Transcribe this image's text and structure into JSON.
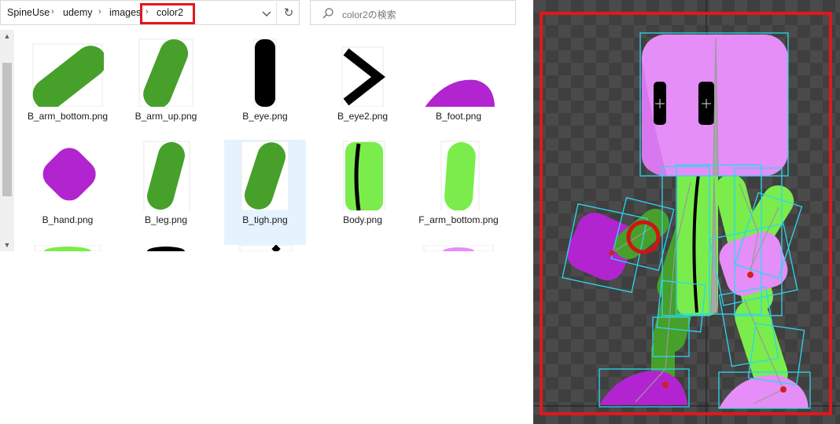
{
  "address_bar": {
    "breadcrumbs": [
      "SpineUse",
      "udemy",
      "images",
      "color2"
    ],
    "highlight_color": "#e0181b"
  },
  "search": {
    "placeholder": "color2の検索"
  },
  "files": [
    {
      "name": "B_arm_bottom.png",
      "color": "#46a02a",
      "shape": "wide-capsule"
    },
    {
      "name": "B_arm_up.png",
      "color": "#46a02a",
      "shape": "capsule"
    },
    {
      "name": "B_eye.png",
      "color": "#000000",
      "shape": "bar"
    },
    {
      "name": "B_eye2.png",
      "color": "#000000",
      "shape": "chevron"
    },
    {
      "name": "B_foot.png",
      "color": "#b224cf",
      "shape": "half-dome"
    },
    {
      "name": "B_hand.png",
      "color": "#b224cf",
      "shape": "diamond"
    },
    {
      "name": "B_leg.png",
      "color": "#46a02a",
      "shape": "capsule"
    },
    {
      "name": "B_tigh.png",
      "color": "#46a02a",
      "shape": "capsule",
      "selected": true
    },
    {
      "name": "Body.png",
      "color": "#7aed4c",
      "shape": "body"
    },
    {
      "name": "F_arm_bottom.png",
      "color": "#7aed4c",
      "shape": "capsule"
    }
  ],
  "spine": {
    "colors": {
      "head": "#e58ef7",
      "body": "#7aed4c",
      "dark_limb": "#46a02a",
      "hand": "#b224cf",
      "bounds": "#2ad8ef",
      "frame": "#e0181b",
      "selection_ring": "#d01414"
    }
  }
}
